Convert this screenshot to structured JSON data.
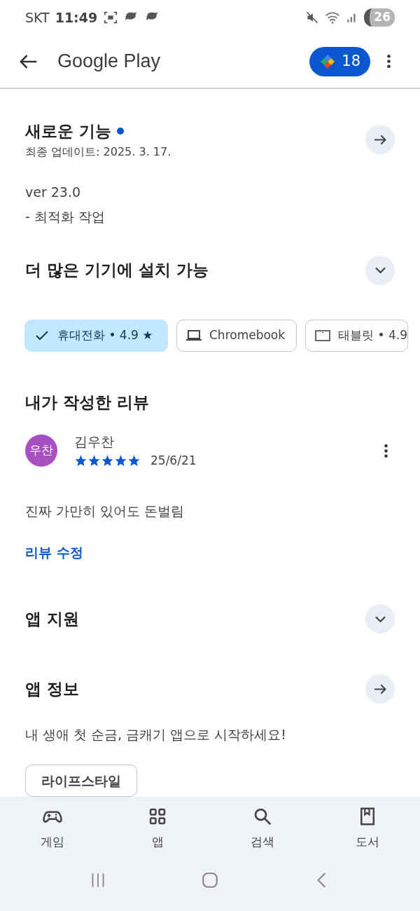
{
  "status_bar": {
    "carrier": "SKT",
    "time": "11:49",
    "battery": "26"
  },
  "app_bar": {
    "title": "Google Play",
    "points": "18"
  },
  "whats_new": {
    "title": "새로운 기능",
    "unread": true,
    "updated": "최종 업데이트: 2025. 3. 17.",
    "lines": [
      "ver 23.0",
      "- 최적화 작업"
    ]
  },
  "devices": {
    "title": "더 많은 기기에 설치 가능",
    "expanded": false,
    "chips": [
      {
        "kind": "check",
        "label": "휴대전화 • 4.9 ★",
        "selected": true
      },
      {
        "kind": "laptop",
        "label": "Chromebook",
        "selected": false
      },
      {
        "kind": "tablet",
        "label": "태블릿 • 4.9",
        "selected": false
      }
    ]
  },
  "my_review": {
    "title": "내가 작성한 리뷰",
    "avatar": "우찬",
    "author": "김우찬",
    "stars": 5,
    "date": "25/6/21",
    "text": "진짜 가만히 있어도 돈벌림",
    "edit_link": "리뷰 수정"
  },
  "app_support": {
    "title": "앱 지원",
    "expanded": false
  },
  "app_info": {
    "title": "앱 정보",
    "description": "내 생애 첫 순금, 금캐기 앱으로 시작하세요!",
    "tag": "라이프스타일"
  },
  "bottom_nav": [
    {
      "kind": "games",
      "label": "게임",
      "selected": false
    },
    {
      "kind": "apps",
      "label": "앱",
      "selected": false
    },
    {
      "kind": "search",
      "label": "검색",
      "selected": false
    },
    {
      "kind": "books",
      "label": "도서",
      "selected": false
    }
  ]
}
